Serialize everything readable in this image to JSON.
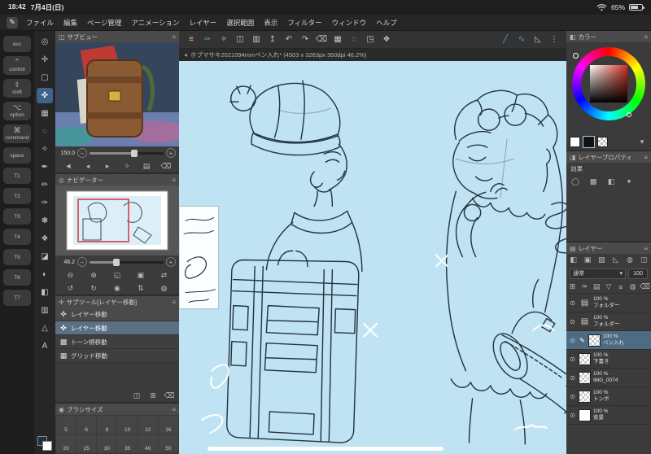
{
  "theme": {
    "accent": "#4aa3d8",
    "canvas": "#bfe3f2",
    "ink": "#233240",
    "sel": "#d04040"
  },
  "ui": {
    "panel_menu": "≡",
    "tab_chevron": "◂",
    "caret": "▾"
  },
  "status": {
    "time": "18:42",
    "date": "7月4日(日)",
    "battery": "65%"
  },
  "menubar": {
    "brand_glyph": "✎",
    "items": [
      "ファイル",
      "編集",
      "ページ管理",
      "アニメーション",
      "レイヤー",
      "選択範囲",
      "表示",
      "フィルター",
      "ウィンドウ",
      "ヘルプ"
    ]
  },
  "modifiers": {
    "items": [
      {
        "label": "esc"
      },
      {
        "glyph": "⌃",
        "label": "control"
      },
      {
        "glyph": "⇧",
        "label": "shift"
      },
      {
        "glyph": "⌥",
        "label": "option"
      },
      {
        "glyph": "⌘",
        "label": "command"
      },
      {
        "label": "space"
      },
      {
        "label": "T1"
      },
      {
        "label": "T2"
      },
      {
        "label": "T3"
      },
      {
        "label": "T4"
      },
      {
        "label": "T5"
      },
      {
        "label": "T6"
      },
      {
        "label": "T7"
      }
    ]
  },
  "tools": {
    "fg_color": "#1c333f",
    "bg_color": "#ffffff",
    "items": [
      {
        "name": "zoom",
        "glyph": "◎"
      },
      {
        "name": "move-canvas",
        "glyph": "✛"
      },
      {
        "name": "operation",
        "glyph": "▢"
      },
      {
        "name": "layer-move",
        "glyph": "✜",
        "selected": true
      },
      {
        "name": "selection",
        "glyph": "▦"
      },
      {
        "name": "lasso",
        "glyph": "◌"
      },
      {
        "name": "eyedropper",
        "glyph": "✧"
      },
      {
        "name": "pen",
        "glyph": "✒"
      },
      {
        "name": "pencil",
        "glyph": "✏"
      },
      {
        "name": "brush",
        "glyph": "✑"
      },
      {
        "name": "airbrush",
        "glyph": "❃"
      },
      {
        "name": "decoration",
        "glyph": "❖"
      },
      {
        "name": "eraser",
        "glyph": "◪"
      },
      {
        "name": "blend",
        "glyph": "◐"
      },
      {
        "name": "fill",
        "glyph": "◧"
      },
      {
        "name": "gradient",
        "glyph": "▥"
      },
      {
        "name": "figure",
        "glyph": "△"
      },
      {
        "name": "text",
        "glyph": "A"
      }
    ]
  },
  "subview": {
    "icon": "◫",
    "title": "サブビュー",
    "zoom": "150.0",
    "controls": [
      {
        "name": "auto-switch",
        "glyph": "◄"
      },
      {
        "name": "prev-image",
        "glyph": "◂"
      },
      {
        "name": "next-image",
        "glyph": "▸"
      },
      {
        "name": "eyedropper-toggle",
        "glyph": "✧"
      },
      {
        "name": "open-file",
        "glyph": "▤"
      },
      {
        "name": "trash",
        "glyph": "⌫"
      }
    ]
  },
  "navigator": {
    "icon": "◎",
    "title": "ナビゲーター",
    "zoom": "46.2",
    "controls1": [
      {
        "name": "zoom-out",
        "glyph": "⊖"
      },
      {
        "name": "zoom-in",
        "glyph": "⊕"
      },
      {
        "name": "fit-to-window",
        "glyph": "◱"
      },
      {
        "name": "actual-size",
        "glyph": "▣"
      },
      {
        "name": "flip-horizontal",
        "glyph": "⇄"
      }
    ],
    "controls2": [
      {
        "name": "rotate-left",
        "glyph": "↺"
      },
      {
        "name": "rotate-right",
        "glyph": "↻"
      },
      {
        "name": "reset-view",
        "glyph": "◉"
      },
      {
        "name": "scroll-lock",
        "glyph": "⇅"
      },
      {
        "name": "reset-rotation",
        "glyph": "◍"
      }
    ]
  },
  "subtool": {
    "icon": "✛",
    "title": "サブツール[レイヤー移動]",
    "items": [
      {
        "glyph": "✜",
        "label": "レイヤー移動",
        "group": true
      },
      {
        "glyph": "✜",
        "label": "レイヤー移動",
        "selected": true
      },
      {
        "glyph": "▩",
        "label": "トーン柄移動"
      },
      {
        "glyph": "▦",
        "label": "グリッド移動"
      }
    ],
    "footer": [
      {
        "name": "duplicate-subtool",
        "glyph": "◫"
      },
      {
        "name": "new-subtool",
        "glyph": "⊞"
      },
      {
        "name": "delete-subtool",
        "glyph": "⌫"
      }
    ]
  },
  "brush": {
    "icon": "◉",
    "title": "ブラシサイズ",
    "sizes": [
      "5",
      "6",
      "8",
      "10",
      "12",
      "16",
      "20",
      "25",
      "30",
      "35",
      "40",
      "50"
    ]
  },
  "toolbar": {
    "items": [
      {
        "name": "main-menu",
        "glyph": "≡"
      },
      {
        "name": "quick-pen",
        "glyph": "✑",
        "accent": true
      },
      {
        "name": "quick-eyedropper",
        "glyph": "✧"
      },
      {
        "name": "new-page",
        "glyph": "◫"
      },
      {
        "name": "import-image",
        "glyph": "▥"
      },
      {
        "name": "save",
        "glyph": "↥"
      },
      {
        "name": "undo",
        "glyph": "↶"
      },
      {
        "name": "redo",
        "glyph": "↷"
      },
      {
        "name": "clear",
        "glyph": "⌫"
      },
      {
        "name": "select-rectangle",
        "glyph": "▦"
      },
      {
        "name": "deselect",
        "glyph": "◌"
      },
      {
        "name": "transform",
        "glyph": "◳"
      },
      {
        "name": "material",
        "glyph": "❖"
      },
      {
        "name": "spacer",
        "glyph": "",
        "spacer": true
      },
      {
        "name": "straight-line-snap",
        "glyph": "╱",
        "accent": true
      },
      {
        "name": "curve-snap",
        "glyph": "∿",
        "accent": true
      },
      {
        "name": "ruler-snap",
        "glyph": "◺"
      },
      {
        "name": "more-options",
        "glyph": "⋮"
      }
    ]
  },
  "document": {
    "tab": "ホブマサキ2021094mmペン入れ* (4503 x 3263px 350dpi 46.2%)"
  },
  "colorp": {
    "icon": "◧",
    "title": "カラー"
  },
  "layerprop": {
    "icon": "◨",
    "title": "レイヤープロパティ",
    "effect_label": "効果",
    "icons": [
      {
        "name": "border-effect",
        "glyph": "◯"
      },
      {
        "name": "tone-effect",
        "glyph": "▩"
      },
      {
        "name": "expression-color",
        "glyph": "◧"
      },
      {
        "name": "extract-line",
        "glyph": "✦"
      }
    ]
  },
  "layers": {
    "icon": "▤",
    "title": "レイヤー",
    "blend": "通常",
    "opacity": "100",
    "eye": "⊙",
    "edit": "✎",
    "folder": "▤",
    "toolbar_top": [
      {
        "name": "palette-color",
        "glyph": "◧"
      },
      {
        "name": "lock-layer",
        "glyph": "▣"
      },
      {
        "name": "lock-transparent-pixels",
        "glyph": "▨"
      },
      {
        "name": "set-ruler",
        "glyph": "◺"
      },
      {
        "name": "enable-mask",
        "glyph": "◍"
      },
      {
        "name": "two-pane-view",
        "glyph": "◫"
      }
    ],
    "toolbar": [
      {
        "name": "new-raster-layer",
        "glyph": "⊞"
      },
      {
        "name": "new-vector-layer",
        "glyph": "✑"
      },
      {
        "name": "new-folder",
        "glyph": "▤"
      },
      {
        "name": "transfer-down",
        "glyph": "▽"
      },
      {
        "name": "merge-down",
        "glyph": "≡"
      },
      {
        "name": "layer-mask",
        "glyph": "◍"
      },
      {
        "name": "delete-layer",
        "glyph": "⌫"
      }
    ],
    "items": [
      {
        "opacity": "100 %",
        "name": "フォルダー",
        "folder": true
      },
      {
        "opacity": "100 %",
        "name": "フォルダー",
        "folder": true
      },
      {
        "opacity": "100 %",
        "name": "ペン入れ",
        "checker": true,
        "selected": true,
        "edit": true
      },
      {
        "opacity": "100 %",
        "name": "下書き",
        "checker": true
      },
      {
        "opacity": "100 %",
        "name": "IMG_0074",
        "checker": true
      },
      {
        "opacity": "100 %",
        "name": "トンボ",
        "checker": true
      },
      {
        "opacity": "100 %",
        "name": "背景",
        "white": true
      }
    ]
  }
}
